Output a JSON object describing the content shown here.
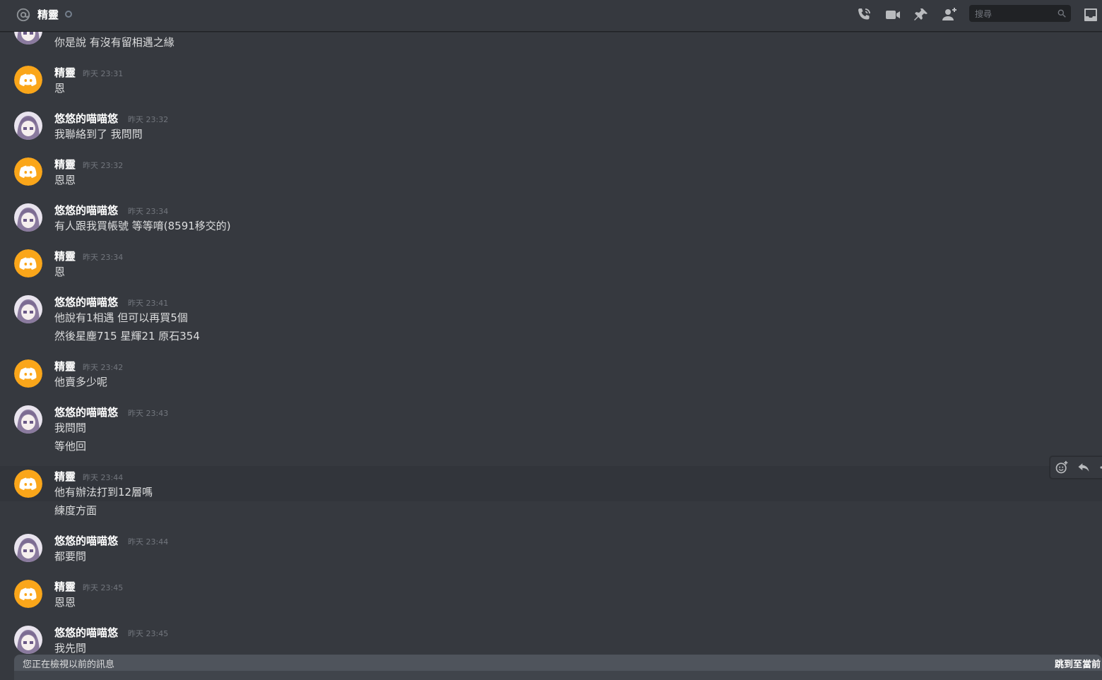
{
  "header": {
    "channel_name": "精靈",
    "search_placeholder": "搜尋"
  },
  "messages": [
    {
      "author": "",
      "time": "",
      "lines": [
        "你是說 有沒有留相遇之緣"
      ]
    },
    {
      "author": "精靈",
      "time": "昨天 23:31",
      "lines": [
        "恩"
      ]
    },
    {
      "author": "悠悠的喵喵悠",
      "time": "昨天 23:32",
      "lines": [
        "我聯絡到了 我問問"
      ]
    },
    {
      "author": "精靈",
      "time": "昨天 23:32",
      "lines": [
        "恩恩"
      ]
    },
    {
      "author": "悠悠的喵喵悠",
      "time": "昨天 23:34",
      "lines": [
        "有人跟我買帳號 等等唷(8591移交的)"
      ]
    },
    {
      "author": "精靈",
      "time": "昨天 23:34",
      "lines": [
        "恩"
      ]
    },
    {
      "author": "悠悠的喵喵悠",
      "time": "昨天 23:41",
      "lines": [
        "他說有1相遇 但可以再買5個",
        "然後星塵715 星輝21 原石354"
      ]
    },
    {
      "author": "精靈",
      "time": "昨天 23:42",
      "lines": [
        "他賣多少呢"
      ]
    },
    {
      "author": "悠悠的喵喵悠",
      "time": "昨天 23:43",
      "lines": [
        "我問問",
        "等他回"
      ]
    },
    {
      "author": "精靈",
      "time": "昨天 23:44",
      "lines": [
        "他有辦法打到12層嗎",
        "練度方面"
      ]
    },
    {
      "author": "悠悠的喵喵悠",
      "time": "昨天 23:44",
      "lines": [
        "都要問"
      ]
    },
    {
      "author": "精靈",
      "time": "昨天 23:45",
      "lines": [
        "恩恩"
      ]
    },
    {
      "author": "悠悠的喵喵悠",
      "time": "昨天 23:45",
      "lines": [
        "我先問"
      ]
    }
  ],
  "footer": {
    "older_notice": "您正在檢視以前的訊息",
    "jump_label": "跳到至當前"
  },
  "colors": {
    "background": "#36393f",
    "discord_avatar": "#faa61a",
    "older_bar": "#4f545c"
  },
  "icons": [
    "at-icon",
    "phone-call-icon",
    "video-call-icon",
    "pin-icon",
    "add-friend-icon",
    "search-icon",
    "inbox-icon",
    "add-reaction-icon",
    "reply-icon"
  ]
}
